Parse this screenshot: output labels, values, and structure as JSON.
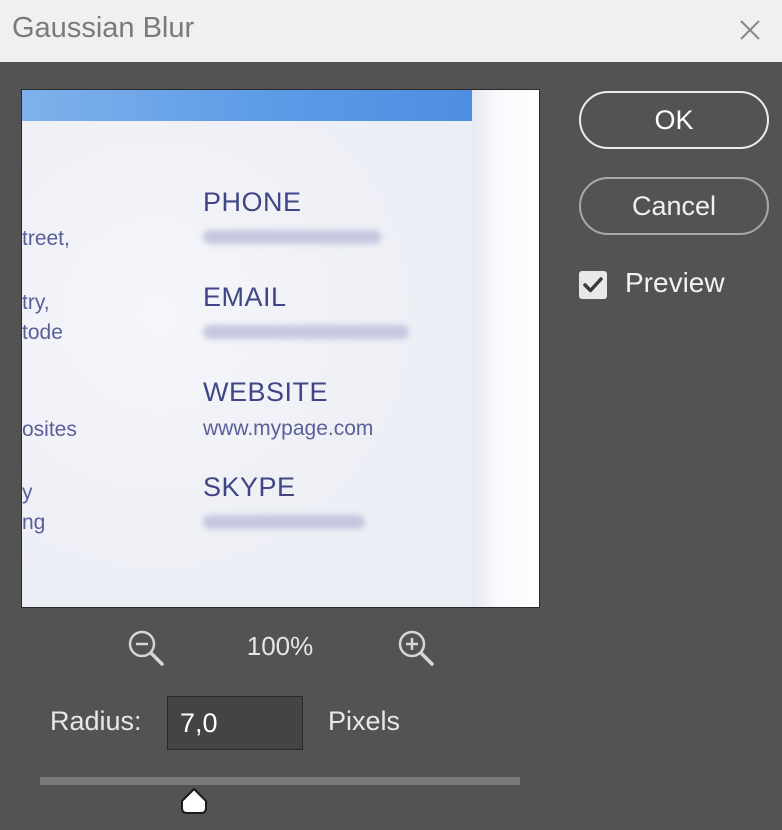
{
  "dialog": {
    "title": "Gaussian Blur",
    "close_icon": "close-icon"
  },
  "preview_image": {
    "left_fragments": [
      "treet,",
      "try,",
      "tode",
      "osites",
      "y",
      "ng"
    ],
    "labels": [
      "PHONE",
      "EMAIL",
      "WEBSITE",
      "SKYPE"
    ],
    "website_value": "www.mypage.com",
    "band_color": "#5c9be6"
  },
  "zoom": {
    "out_icon": "zoom-out-icon",
    "in_icon": "zoom-in-icon",
    "level": "100%"
  },
  "buttons": {
    "ok": "OK",
    "cancel": "Cancel"
  },
  "preview_toggle": {
    "label": "Preview",
    "checked": true
  },
  "radius": {
    "label": "Radius:",
    "value": "7,0",
    "unit": "Pixels"
  },
  "slider": {
    "value_fraction": 0.32
  }
}
